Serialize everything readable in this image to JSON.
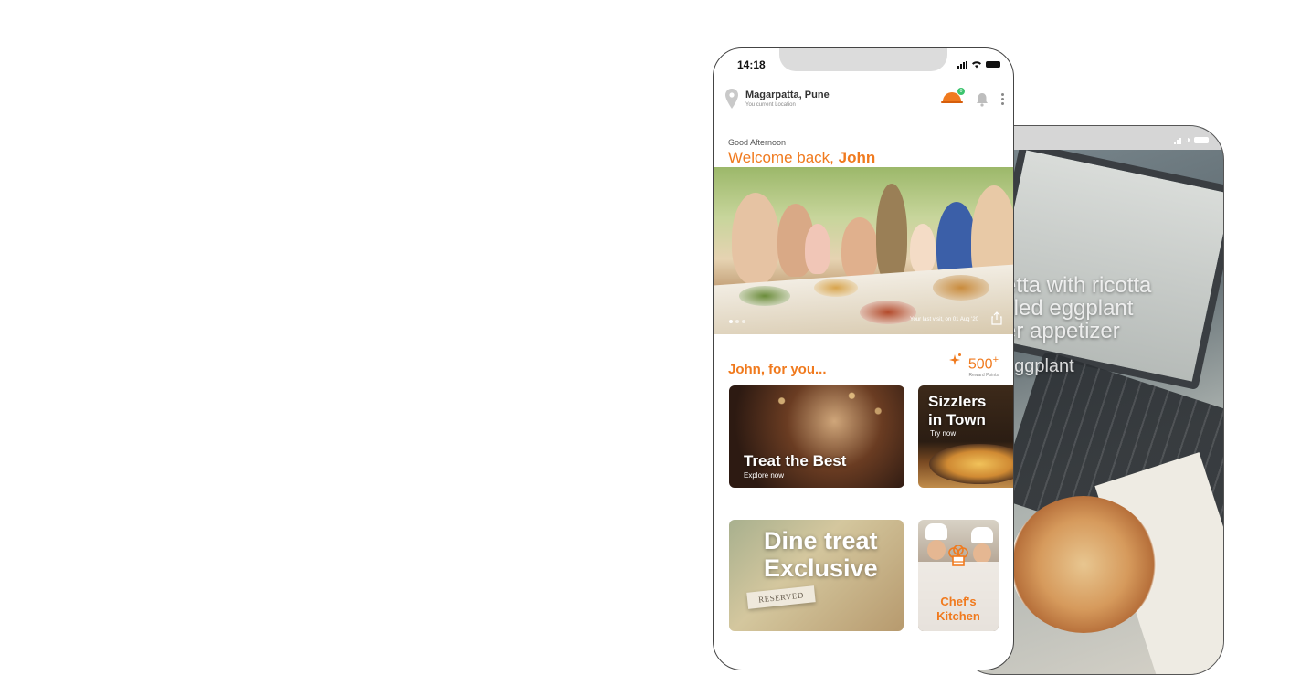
{
  "back_phone": {
    "caption_lines": [
      "etta with ricotta",
      "illed eggplant",
      "er appetizer"
    ],
    "caption_sub": "eggplant"
  },
  "status": {
    "time": "14:18"
  },
  "header": {
    "location": "Magarpatta, Pune",
    "location_sub": "You current Location",
    "cart_badge": "0"
  },
  "greeting": {
    "small": "Good Afternoon",
    "prefix": "Welcome back, ",
    "name": "John"
  },
  "hero": {
    "caption": "Your last visit, on 01 Aug '20"
  },
  "for_you": {
    "title": "John, for you...",
    "points": "500",
    "points_plus": "+",
    "points_label": "Reward Points"
  },
  "cards": [
    {
      "title": "Treat the Best",
      "subtitle": "Explore now"
    },
    {
      "title_line1": "Sizzlers",
      "title_line2": "in Town",
      "subtitle": "Try now"
    },
    {
      "title_line1": "Dine treat",
      "title_line2": "Exclusive",
      "sign": "RESERVED"
    },
    {
      "title_line1": "Chef's",
      "title_line2": "Kitchen"
    }
  ],
  "colors": {
    "accent": "#f07a1e",
    "badge": "#3cc46e"
  }
}
